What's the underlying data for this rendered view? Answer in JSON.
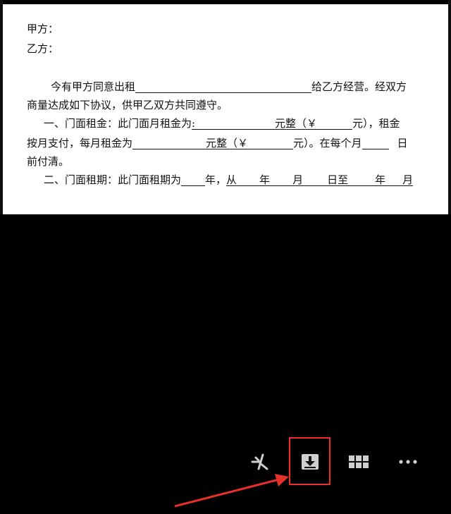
{
  "document": {
    "party_a": "甲方：",
    "party_b": "乙方：",
    "para1_start": "今有甲方同意出租",
    "para1_mid": "给乙方经营。经双方",
    "para1_line2": "商量达成如下协议，供甲乙双方共同遵守。",
    "rent_line1_lead": "一、门面租金：此门面月租金为",
    "rent_colon": ":",
    "rent_yuan_whole": "元整（￥",
    "rent_yuan_close": "元），租金",
    "rent_line2_lead": "按月支付，每月租金为",
    "rent_line2_yuan_whole": "元整（￥",
    "rent_line2_yuan_close": "元）。在每个月",
    "rent_line2_day": "日",
    "rent_line3": "前付清。",
    "term_lead": "二、门面租期：此门面租期为",
    "term_year": "年，",
    "term_from": "从",
    "term_y1": "年",
    "term_m1": "月",
    "term_d1": "日至",
    "term_y2": "年",
    "term_m2": "月"
  },
  "toolbar": {
    "items": [
      {
        "icon": "star-pen-icon"
      },
      {
        "icon": "download-icon"
      },
      {
        "icon": "grid-icon"
      },
      {
        "icon": "more-icon"
      }
    ]
  },
  "colors": {
    "highlight": "#e8302a",
    "icon": "#cfcfcf",
    "background": "#000000"
  }
}
